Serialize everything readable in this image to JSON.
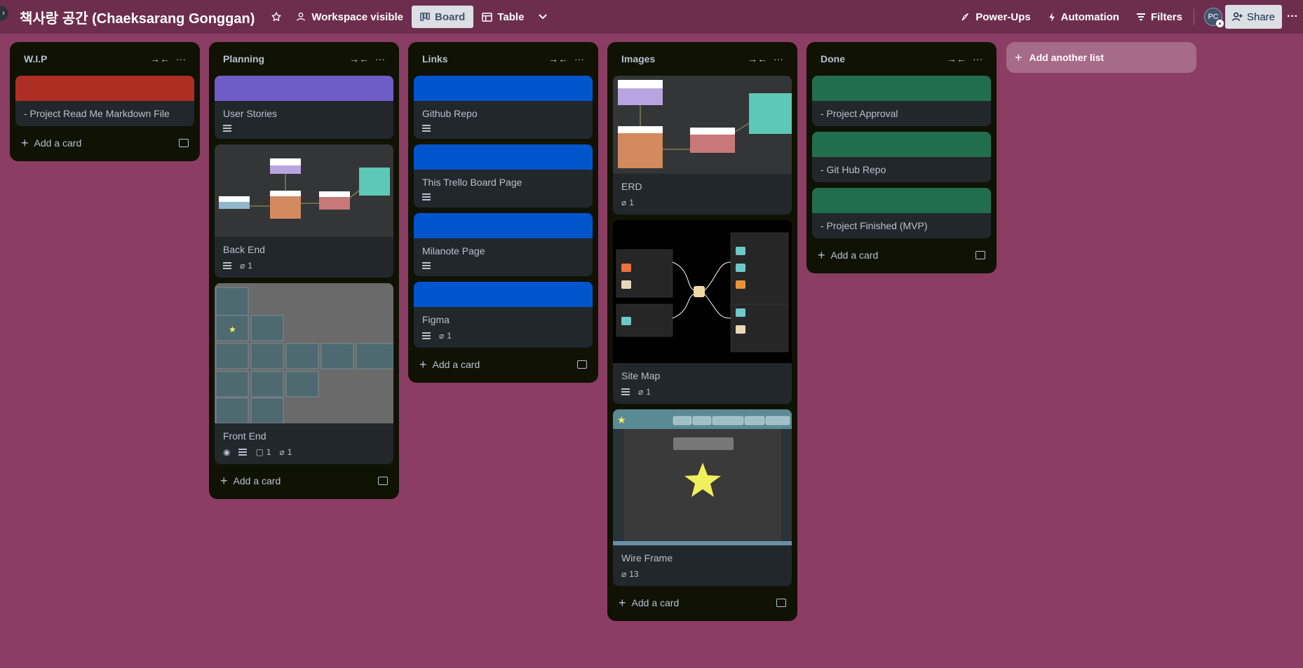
{
  "header": {
    "board_title": "책사랑 공간 (Chaeksarang Gonggan)",
    "visibility_label": "Workspace visible",
    "views": [
      {
        "label": "Board",
        "icon": "board-icon"
      },
      {
        "label": "Table",
        "icon": "table-icon"
      }
    ],
    "powerups_label": "Power-Ups",
    "automation_label": "Automation",
    "filters_label": "Filters",
    "avatar_initials": "PC",
    "share_label": "Share"
  },
  "lists": [
    {
      "title": "W.I.P",
      "cards": [
        {
          "title": "- Project Read Me Markdown File",
          "cover_color": "#ae2e24"
        }
      ],
      "add_card_label": "Add a card"
    },
    {
      "title": "Planning",
      "cards": [
        {
          "title": "User Stories",
          "cover_color": "#6e5dc6",
          "has_description": true
        },
        {
          "title": "Back End",
          "image_cover": "erd-diagram",
          "has_description": true,
          "attachments": "1"
        },
        {
          "title": "Front End",
          "image_cover": "wireframe-grid",
          "watching": true,
          "has_description": true,
          "comments": "1",
          "attachments": "1"
        }
      ],
      "add_card_label": "Add a card"
    },
    {
      "title": "Links",
      "cards": [
        {
          "title": "Github Repo",
          "cover_color": "#0055cc",
          "has_description": true
        },
        {
          "title": "This Trello Board Page",
          "cover_color": "#0055cc",
          "has_description": true
        },
        {
          "title": "Milanote Page",
          "cover_color": "#0055cc",
          "has_description": true
        },
        {
          "title": "Figma",
          "cover_color": "#0055cc",
          "has_description": true,
          "attachments": "1"
        }
      ],
      "add_card_label": "Add a card"
    },
    {
      "title": "Images",
      "cards": [
        {
          "title": "ERD",
          "image_cover": "erd-diagram",
          "attachments": "1"
        },
        {
          "title": "Site Map",
          "image_cover": "site-map",
          "has_description": true,
          "attachments": "1"
        },
        {
          "title": "Wire Frame",
          "image_cover": "wire-frame",
          "attachments": "13"
        }
      ],
      "add_card_label": "Add a card"
    },
    {
      "title": "Done",
      "cards": [
        {
          "title": "- Project Approval",
          "cover_color": "#216e4e"
        },
        {
          "title": "- Git Hub Repo",
          "cover_color": "#216e4e"
        },
        {
          "title": "- Project Finished (MVP)",
          "cover_color": "#216e4e"
        }
      ],
      "add_card_label": "Add a card"
    }
  ],
  "add_list_label": "Add another list",
  "colors": {
    "board_background": "#8b3d63",
    "header_background": "#6d2e4e",
    "list_background": "#101204",
    "card_background": "#22272b"
  }
}
